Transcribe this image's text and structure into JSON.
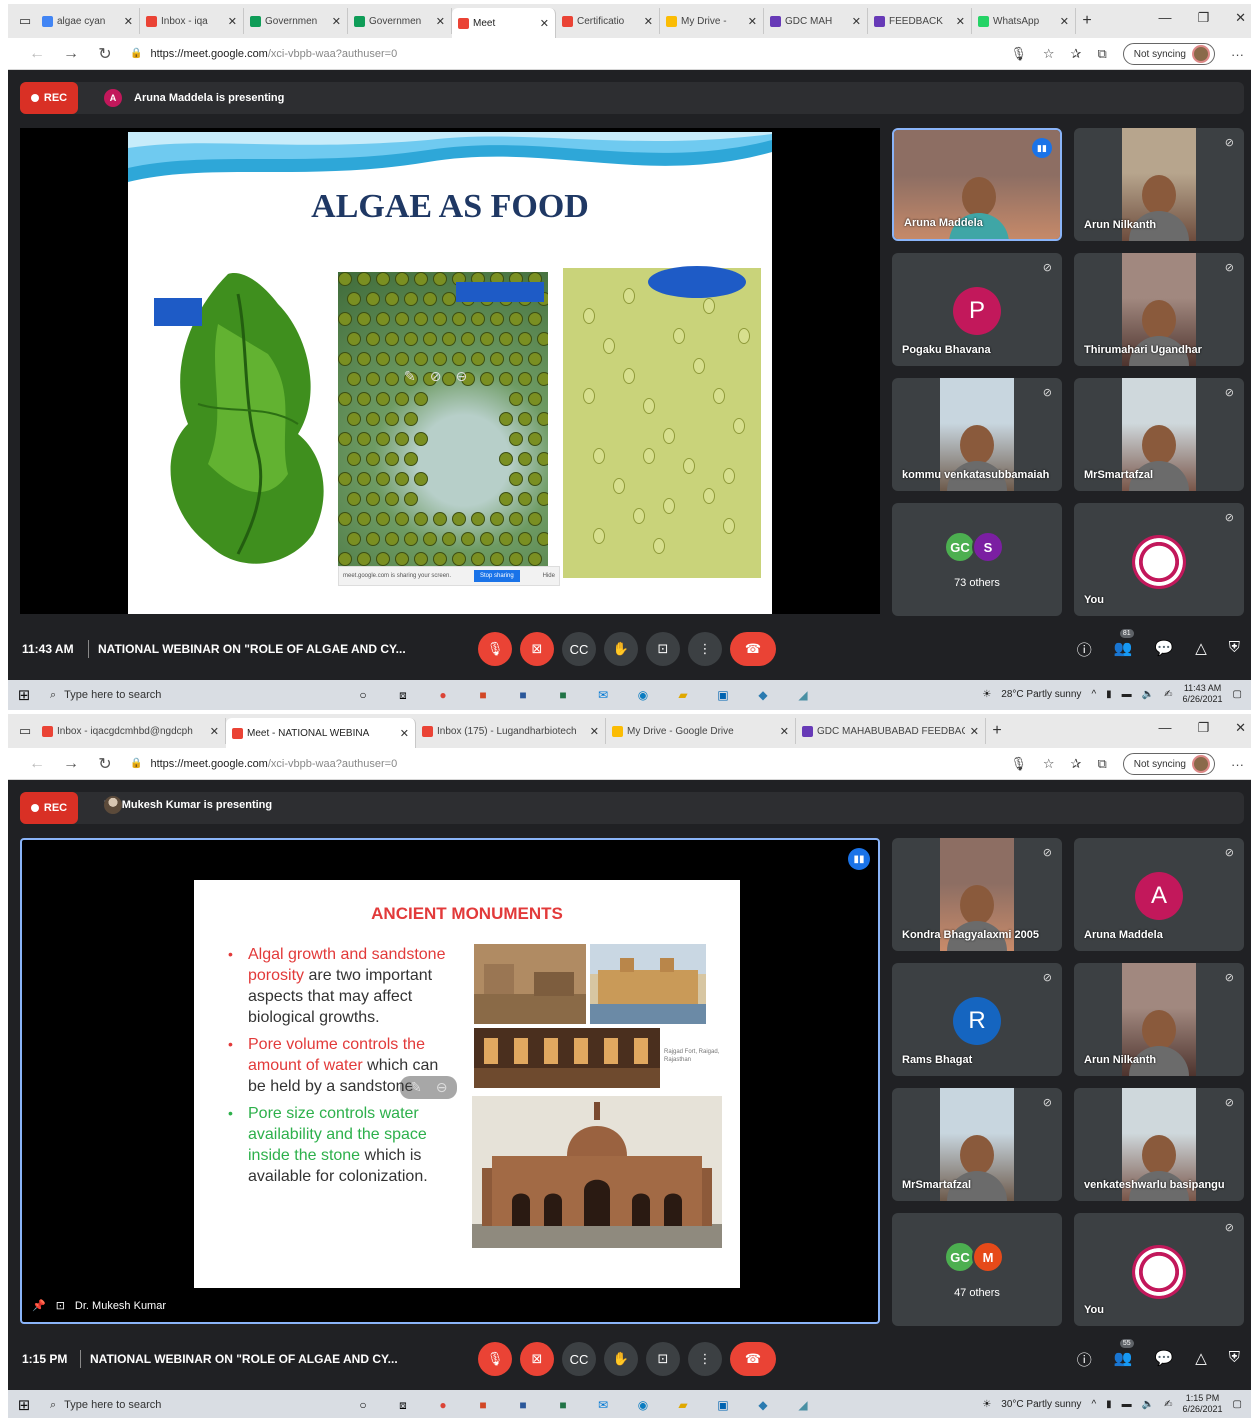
{
  "screens": [
    {
      "tabs": [
        {
          "title": "algae cyan",
          "color": "#4285f4"
        },
        {
          "title": "Inbox - iqa",
          "color": "#ea4335"
        },
        {
          "title": "Governmen",
          "color": "#0f9d58"
        },
        {
          "title": "Governmen",
          "color": "#0f9d58"
        },
        {
          "title": "Meet",
          "color": "#ea4335",
          "active": true
        },
        {
          "title": "Certificatio",
          "color": "#ea4335"
        },
        {
          "title": "My Drive -",
          "color": "#fbbc04"
        },
        {
          "title": "GDC MAH",
          "color": "#673ab7"
        },
        {
          "title": "FEEDBACK",
          "color": "#673ab7"
        },
        {
          "title": "WhatsApp",
          "color": "#25d366"
        }
      ],
      "url_host": "https://meet.google.com",
      "url_path": "/xci-vbpb-waa?authuser=0",
      "sync_label": "Not syncing",
      "rec_label": "REC",
      "presenter_initial": "A",
      "presenter_text": "Aruna Maddela is presenting",
      "slide_title": "ALGAE AS FOOD",
      "share_text": "meet.google.com is sharing your screen.",
      "share_stop": "Stop sharing",
      "share_hide": "Hide",
      "participants": [
        {
          "name": "Aruna Maddela",
          "kind": "cam",
          "active": true
        },
        {
          "name": "Arun Nilkanth",
          "kind": "cam"
        },
        {
          "name": "Pogaku Bhavana",
          "kind": "avatar",
          "initial": "P",
          "color": "#c2185b"
        },
        {
          "name": "Thirumahari Ugandhar",
          "kind": "cam"
        },
        {
          "name": "kommu venkatasubbamaiah",
          "kind": "cam"
        },
        {
          "name": "MrSmartafzal",
          "kind": "cam"
        },
        {
          "name": "",
          "kind": "others",
          "count_label": "73 others",
          "initials": [
            "GC",
            "S"
          ],
          "colors": [
            "#4caf50",
            "#7b1fa2"
          ]
        },
        {
          "name": "You",
          "kind": "logo"
        }
      ],
      "meeting_time": "11:43 AM",
      "meeting_title": "NATIONAL WEBINAR ON \"ROLE OF ALGAE AND CY...",
      "people_count": "81",
      "search_placeholder": "Type here to search",
      "weather": "28°C  Partly sunny",
      "clock_time": "11:43 AM",
      "clock_date": "6/26/2021"
    },
    {
      "tabs": [
        {
          "title": "Inbox - iqacgdcmhbd@ngdcph",
          "color": "#ea4335"
        },
        {
          "title": "Meet - NATIONAL WEBINA",
          "color": "#ea4335",
          "active": true
        },
        {
          "title": "Inbox (175) - Lugandharbiotech",
          "color": "#ea4335"
        },
        {
          "title": "My Drive - Google Drive",
          "color": "#fbbc04"
        },
        {
          "title": "GDC MAHABUBABAD FEEDBAC",
          "color": "#673ab7"
        }
      ],
      "url_host": "https://meet.google.com",
      "url_path": "/xci-vbpb-waa?authuser=0",
      "sync_label": "Not syncing",
      "rec_label": "REC",
      "presenter_initial": "",
      "presenter_text": "Dr. Mukesh Kumar is presenting",
      "slide_title": "ANCIENT MONUMENTS",
      "bullets": [
        {
          "em": "Algal growth and sandstone porosity",
          "em_color": "red",
          "rest": " are two important aspects that may affect biological growths."
        },
        {
          "em": "Pore volume controls the amount of water",
          "em_color": "red",
          "rest": " which can be held by a sandstone"
        },
        {
          "em": "Pore size controls water availability and the space inside the stone",
          "em_color": "green",
          "rest": " which is available for colonization."
        }
      ],
      "photo_caption": "Rajgad Fort, Raigad, Rajasthan",
      "stage_footer_name": "Dr. Mukesh Kumar",
      "participants": [
        {
          "name": "Kondra Bhagyalaxmi 2005",
          "kind": "cam"
        },
        {
          "name": "Aruna Maddela",
          "kind": "avatar",
          "initial": "A",
          "color": "#c2185b"
        },
        {
          "name": "Rams Bhagat",
          "kind": "avatar",
          "initial": "R",
          "color": "#1565c0"
        },
        {
          "name": "Arun Nilkanth",
          "kind": "cam"
        },
        {
          "name": "MrSmartafzal",
          "kind": "cam"
        },
        {
          "name": "venkateshwarlu basipangu",
          "kind": "cam"
        },
        {
          "name": "",
          "kind": "others",
          "count_label": "47 others",
          "initials": [
            "GC",
            "M"
          ],
          "colors": [
            "#4caf50",
            "#e64a19"
          ]
        },
        {
          "name": "You",
          "kind": "logo"
        }
      ],
      "meeting_time": "1:15 PM",
      "meeting_title": "NATIONAL WEBINAR ON \"ROLE OF ALGAE AND CY...",
      "people_count": "55",
      "search_placeholder": "Type here to search",
      "weather": "30°C  Partly sunny",
      "clock_time": "1:15 PM",
      "clock_date": "6/26/2021"
    }
  ]
}
